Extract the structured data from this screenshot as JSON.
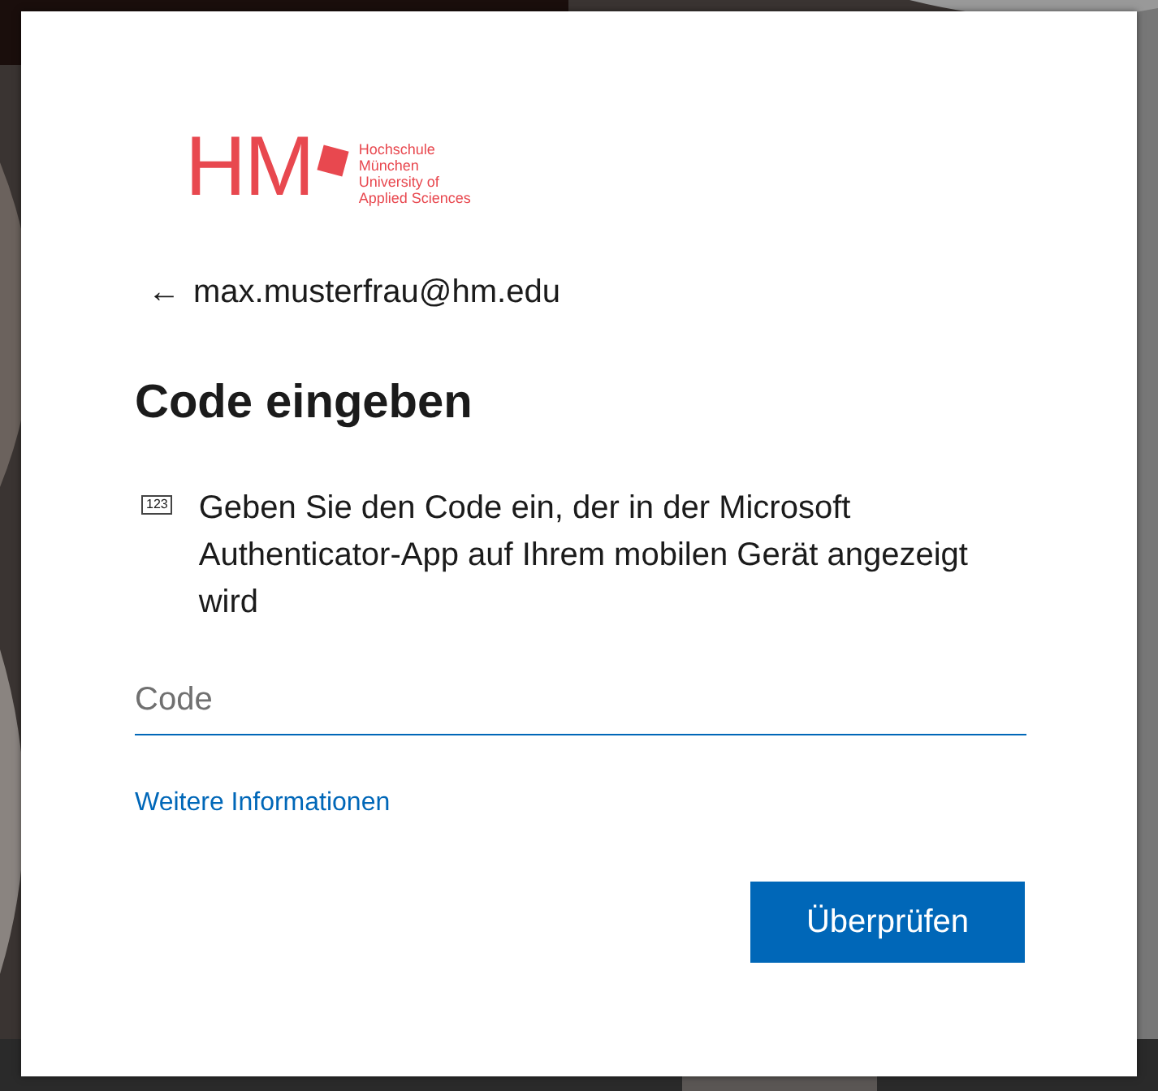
{
  "logo": {
    "mark": "HM",
    "lines": [
      "Hochschule",
      "München",
      "University of",
      "Applied Sciences"
    ]
  },
  "account": {
    "back_glyph": "←",
    "email": "max.musterfrau@hm.edu"
  },
  "title": "Code eingeben",
  "instruction": {
    "icon_text": "123",
    "text": "Geben Sie den Code ein, der in der Microsoft Authenticator-App auf Ihrem mobilen Gerät angezeigt wird"
  },
  "code_field": {
    "placeholder": "Code"
  },
  "more_info_link": "Weitere Informationen",
  "buttons": [
    {
      "label": "Überprüfen",
      "kind": "primary"
    }
  ]
}
